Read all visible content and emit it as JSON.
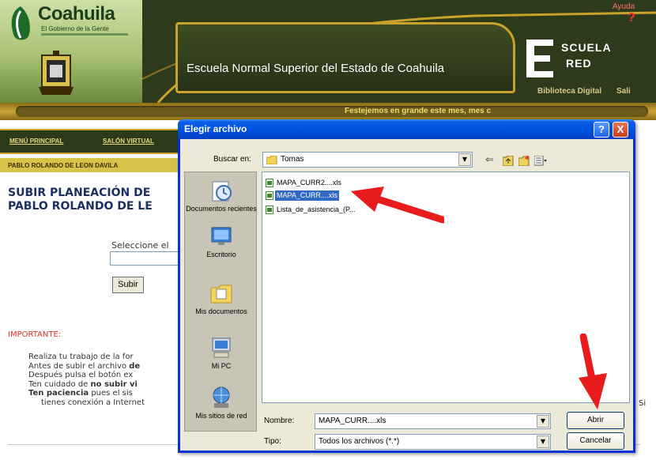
{
  "header": {
    "logo_title": "Coahuila",
    "logo_subtitle": "El Gobierno de la Gente",
    "site_title": "Escuela Normal Superior del Estado de Coahuila",
    "help_label": "Ayuda",
    "help_mark": "?",
    "en_logo_line1": "SCUELA",
    "en_logo_line2": "RED",
    "biblioteca": "Biblioteca Digital",
    "biblioteca_cut": "Sali"
  },
  "ticker": {
    "text": "Festejemos en grande este mes, mes c"
  },
  "nav": {
    "items": [
      {
        "label": "MENÚ PRINCIPAL"
      },
      {
        "label": "SALÓN VIRTUAL"
      }
    ],
    "user": "PABLO ROLANDO DE LEON DAVILA"
  },
  "page": {
    "heading_line1": "SUBIR PLANEACIÓN DE",
    "heading_line2": "PABLO ROLANDO DE LE",
    "select_label": "Seleccione el",
    "upload_button": "Subir",
    "important_label": "IMPORTANTE:",
    "bullets": [
      {
        "text": "Realiza tu trabajo de la for",
        "bold": ""
      },
      {
        "text": "Antes de subir el archivo ",
        "bold": "de"
      },
      {
        "text": "Después pulsa el botón ex",
        "bold": ""
      },
      {
        "text": "Ten cuidado de ",
        "bold": "no subir vi"
      },
      {
        "text": " pues el sis",
        "bold": "Ten paciencia"
      }
    ],
    "bullet_continuation": "tienes conexión a Internet",
    "trailing_text": "Si"
  },
  "dialog": {
    "title": "Elegir archivo",
    "help_button": "?",
    "close_button": "X",
    "look_in_label": "Buscar en:",
    "look_in_value": "Tomas",
    "places": [
      {
        "label": "Documentos recientes",
        "icon": "recent-documents-icon"
      },
      {
        "label": "Escritorio",
        "icon": "desktop-icon"
      },
      {
        "label": "Mis documentos",
        "icon": "my-documents-icon"
      },
      {
        "label": "Mi PC",
        "icon": "my-computer-icon"
      },
      {
        "label": "Mis sitios de red",
        "icon": "network-places-icon"
      }
    ],
    "files": [
      {
        "name": "MAPA_CURR2....xls",
        "selected": false
      },
      {
        "name": "MAPA_CURR....xls",
        "selected": true
      },
      {
        "name": "Lista_de_asistencia_(P...",
        "selected": false
      }
    ],
    "filename_label": "Nombre:",
    "filename_value": "MAPA_CURR....xls",
    "filetype_label": "Tipo:",
    "filetype_value": "Todos los archivos (*.*)",
    "open_button": "Abrir",
    "cancel_button": "Cancelar"
  },
  "colors": {
    "dialog_border": "#0831d9",
    "selection": "#316ac5",
    "annotation_arrow": "#e81c1c",
    "heading": "#1b2f60",
    "important": "#e03030"
  }
}
